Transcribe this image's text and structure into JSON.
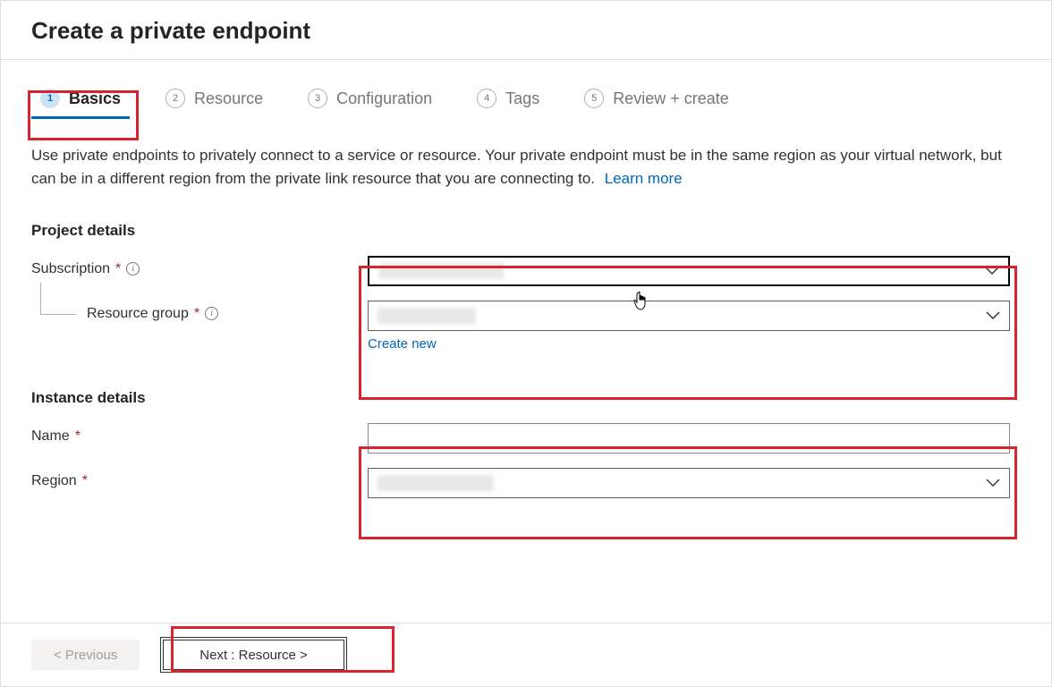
{
  "header": {
    "title": "Create a private endpoint"
  },
  "tabs": [
    {
      "num": "1",
      "label": "Basics",
      "active": true
    },
    {
      "num": "2",
      "label": "Resource",
      "active": false
    },
    {
      "num": "3",
      "label": "Configuration",
      "active": false
    },
    {
      "num": "4",
      "label": "Tags",
      "active": false
    },
    {
      "num": "5",
      "label": "Review + create",
      "active": false
    }
  ],
  "intro": {
    "text": "Use private endpoints to privately connect to a service or resource. Your private endpoint must be in the same region as your virtual network, but can be in a different region from the private link resource that you are connecting to.",
    "learn_more": "Learn more"
  },
  "sections": {
    "project": {
      "title": "Project details",
      "subscription_label": "Subscription",
      "resource_group_label": "Resource group",
      "create_new": "Create new"
    },
    "instance": {
      "title": "Instance details",
      "name_label": "Name",
      "region_label": "Region"
    }
  },
  "fields": {
    "subscription_value": "",
    "resource_group_value": "",
    "name_value": "",
    "region_value": ""
  },
  "footer": {
    "previous": "< Previous",
    "next": "Next : Resource >"
  }
}
